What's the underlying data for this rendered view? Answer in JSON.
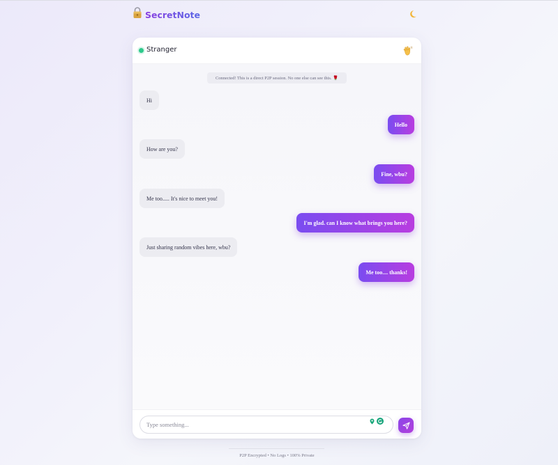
{
  "app": {
    "brand": "SecretNote",
    "icons": {
      "logo": "lock-icon",
      "theme": "moon-icon"
    }
  },
  "chat": {
    "peer_name": "Stranger",
    "peer_status": "online",
    "wave_icon": "waving-hand-icon",
    "system_note": "Connected! This is a direct P2P session. No one else can see this. 🌹",
    "messages": [
      {
        "from": "stranger",
        "text": "Hi"
      },
      {
        "from": "me",
        "text": "Hello"
      },
      {
        "from": "stranger",
        "text": "How are you?"
      },
      {
        "from": "me",
        "text": "Fine, wbu?"
      },
      {
        "from": "stranger",
        "text": "Me too..... It's nice to meet you!"
      },
      {
        "from": "me",
        "text": "I'm glad. can I know what brings you here?"
      },
      {
        "from": "stranger",
        "text": "Just sharing random vibes here, wbu?"
      },
      {
        "from": "me",
        "text": "Me too.... thanks!"
      }
    ]
  },
  "composer": {
    "placeholder": "Type something...",
    "value": "",
    "send_icon": "send-icon"
  },
  "footer": {
    "text": "P2P Encrypted • No Logs • 100% Private"
  },
  "colors": {
    "accent_start": "#7a4cf0",
    "accent_end": "#b83de0",
    "status_online": "#2dc98b",
    "incoming_bubble": "#ececf1"
  }
}
